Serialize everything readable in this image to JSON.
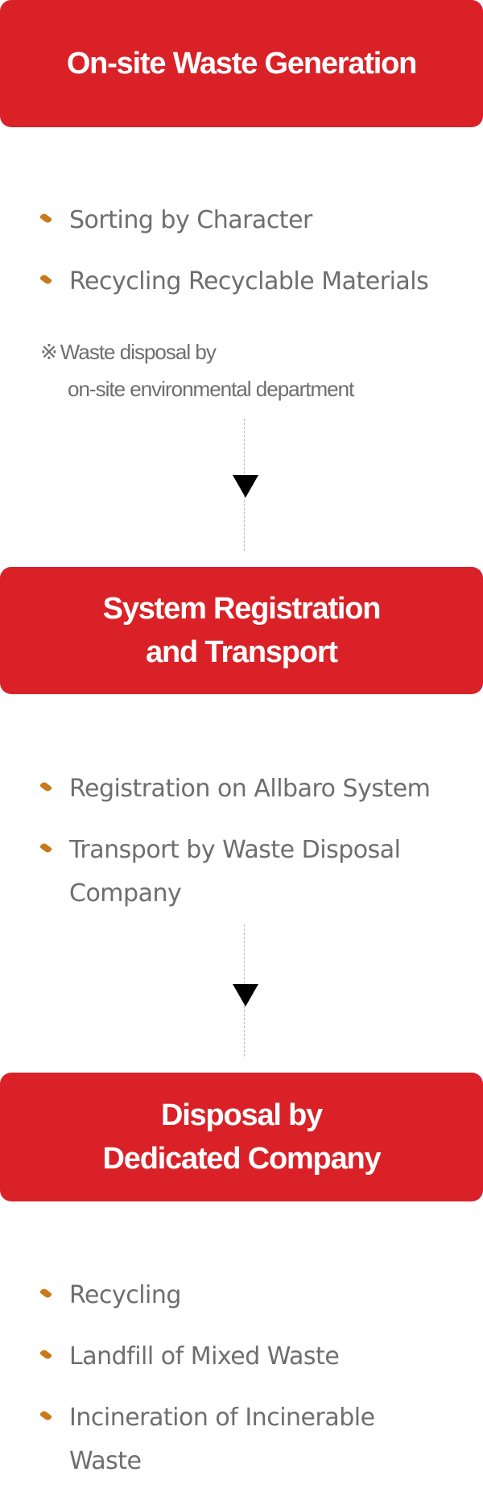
{
  "stages": [
    {
      "title_lines": [
        "On-site Waste Generation"
      ],
      "items": [
        "Sorting by Character",
        "Recycling Recyclable Materials"
      ],
      "note": {
        "mark": "※",
        "line1": "Waste disposal by",
        "line2": "on-site environmental department"
      }
    },
    {
      "title_lines": [
        "System Registration",
        "and Transport"
      ],
      "items": [
        "Registration on Allbaro System",
        "Transport by Waste Disposal Company"
      ]
    },
    {
      "title_lines": [
        "Disposal by",
        "Dedicated Company"
      ],
      "items": [
        "Recycling",
        "Landfill of Mixed Waste",
        "Incineration of Incinerable  Waste"
      ]
    }
  ],
  "colors": {
    "stage_background": "#da2128",
    "stage_text": "#ffffff",
    "item_text": "#6e6e6e",
    "bullet": "#c9791a",
    "arrow": "#000000",
    "connector_line": "#b8b8b8"
  },
  "icons": {
    "bullet": "leaf-bullet-icon",
    "arrow": "arrow-down-icon"
  }
}
